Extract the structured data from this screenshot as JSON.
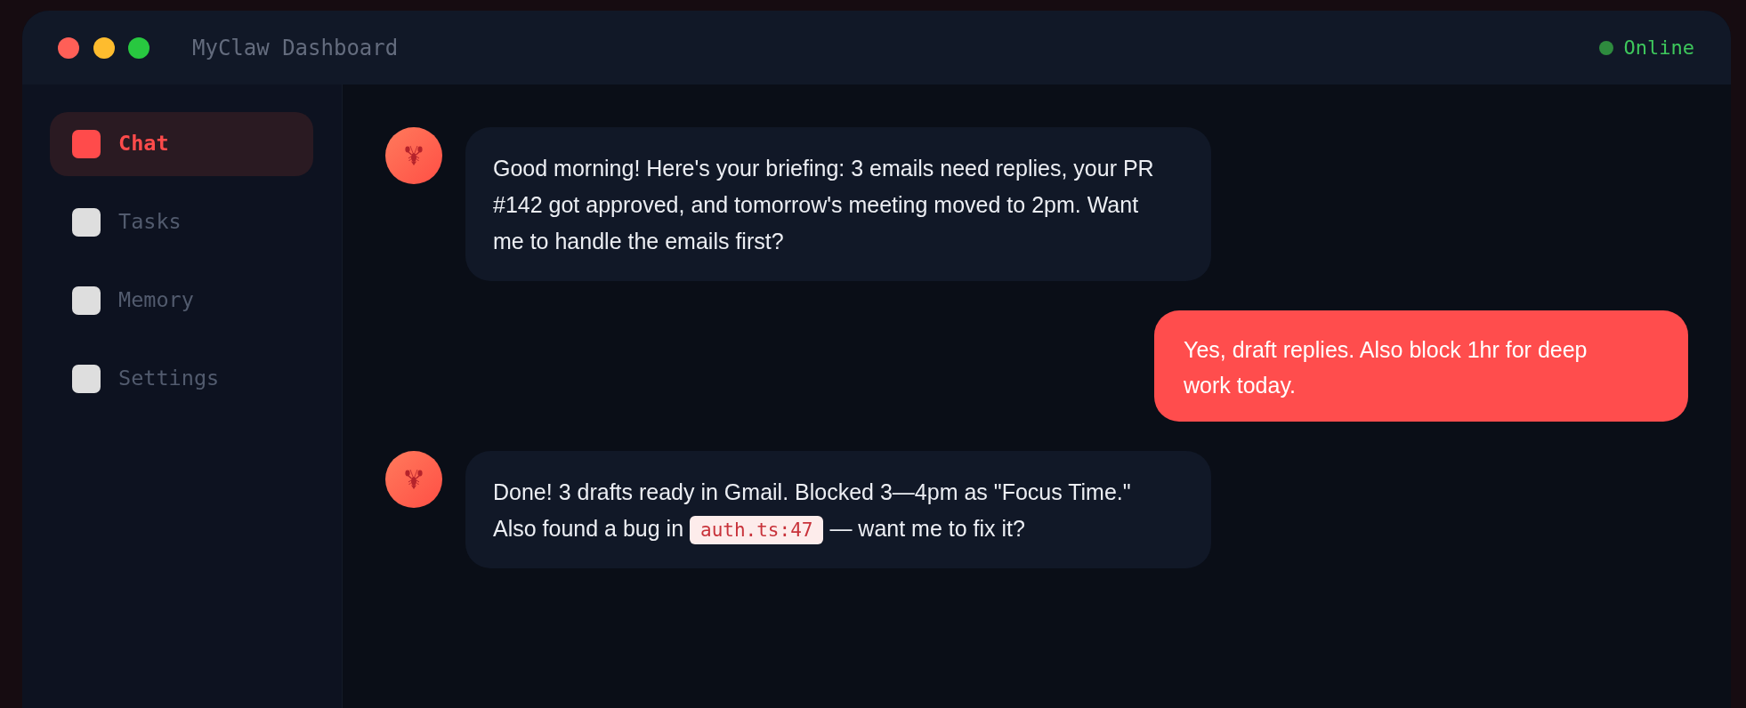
{
  "window": {
    "title": "MyClaw Dashboard"
  },
  "status": {
    "label": "Online",
    "online": true
  },
  "sidebar": {
    "items": [
      {
        "label": "Chat",
        "selected": true
      },
      {
        "label": "Tasks",
        "selected": false
      },
      {
        "label": "Memory",
        "selected": false
      },
      {
        "label": "Settings",
        "selected": false
      }
    ]
  },
  "messages": [
    {
      "kind": "assistant",
      "parts": [
        {
          "kind": "text",
          "text": "Good morning! Here's your briefing: 3 emails need replies, your PR #142 got approved, and tomorrow's meeting moved to 2pm. Want me to handle the emails first?"
        }
      ]
    },
    {
      "kind": "user",
      "parts": [
        {
          "kind": "text",
          "text": "Yes, draft replies. Also block 1hr for deep work today."
        }
      ]
    },
    {
      "kind": "assistant",
      "parts": [
        {
          "kind": "text",
          "text": "Done! 3 drafts ready in Gmail. Blocked 3—4pm as \"Focus Time.\" Also found a bug in "
        },
        {
          "kind": "code",
          "text": "auth.ts:47"
        },
        {
          "kind": "text",
          "text": " — want me to fix it?"
        }
      ]
    }
  ]
}
